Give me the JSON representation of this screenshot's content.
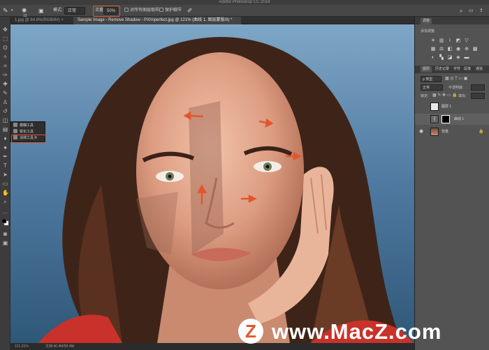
{
  "window": {
    "title": "Adobe Photoshop CC 2018"
  },
  "options_bar": {
    "tool_size": "13",
    "mode_label": "模式:",
    "mode_value": "正常",
    "opacity_label": "流量:",
    "opacity_value": "50%",
    "sample_all_label": "对所有图层取样",
    "protect_label": "保护细节"
  },
  "tabs": [
    {
      "label": "1.jpg @ 84.9%(RGB/8#) ×",
      "active": false
    },
    {
      "label": "Sample Image - Remove Shadow - PXImperfect.jpg @ 121% (曲线 1, 图层蒙版/8) *",
      "active": true
    }
  ],
  "flyout": {
    "items": [
      {
        "label": "模糊工具",
        "icon": "blur-icon"
      },
      {
        "label": "锐化工具",
        "icon": "sharpen-icon"
      },
      {
        "label": "涂抹工具",
        "shortcut": "R",
        "icon": "smudge-icon"
      }
    ]
  },
  "status_bar": {
    "zoom": "121.21%",
    "doc": "文档:46.4M/58.4M"
  },
  "panels": {
    "top_tab": "调整",
    "adjust_title": "添加调整",
    "layer_tabs": [
      "图层",
      "历史记录",
      "字符",
      "段落",
      "通道"
    ],
    "kind_label": "ρ 类型",
    "blend_mode": "正常",
    "opacity_label": "不透明度:",
    "lock_label": "锁定:",
    "fill_label": "填充:",
    "layers": [
      {
        "name": "图层 1",
        "visible": false
      },
      {
        "name": "曲线 1",
        "visible": false
      },
      {
        "name": "背景",
        "visible": true,
        "locked": true
      }
    ]
  },
  "watermark": {
    "logo_letter": "Z",
    "text": "www.MacZ.com"
  },
  "colors": {
    "accent": "#e2562d",
    "panel": "#3a3a3a",
    "toolbar": "#3c3c3c"
  }
}
